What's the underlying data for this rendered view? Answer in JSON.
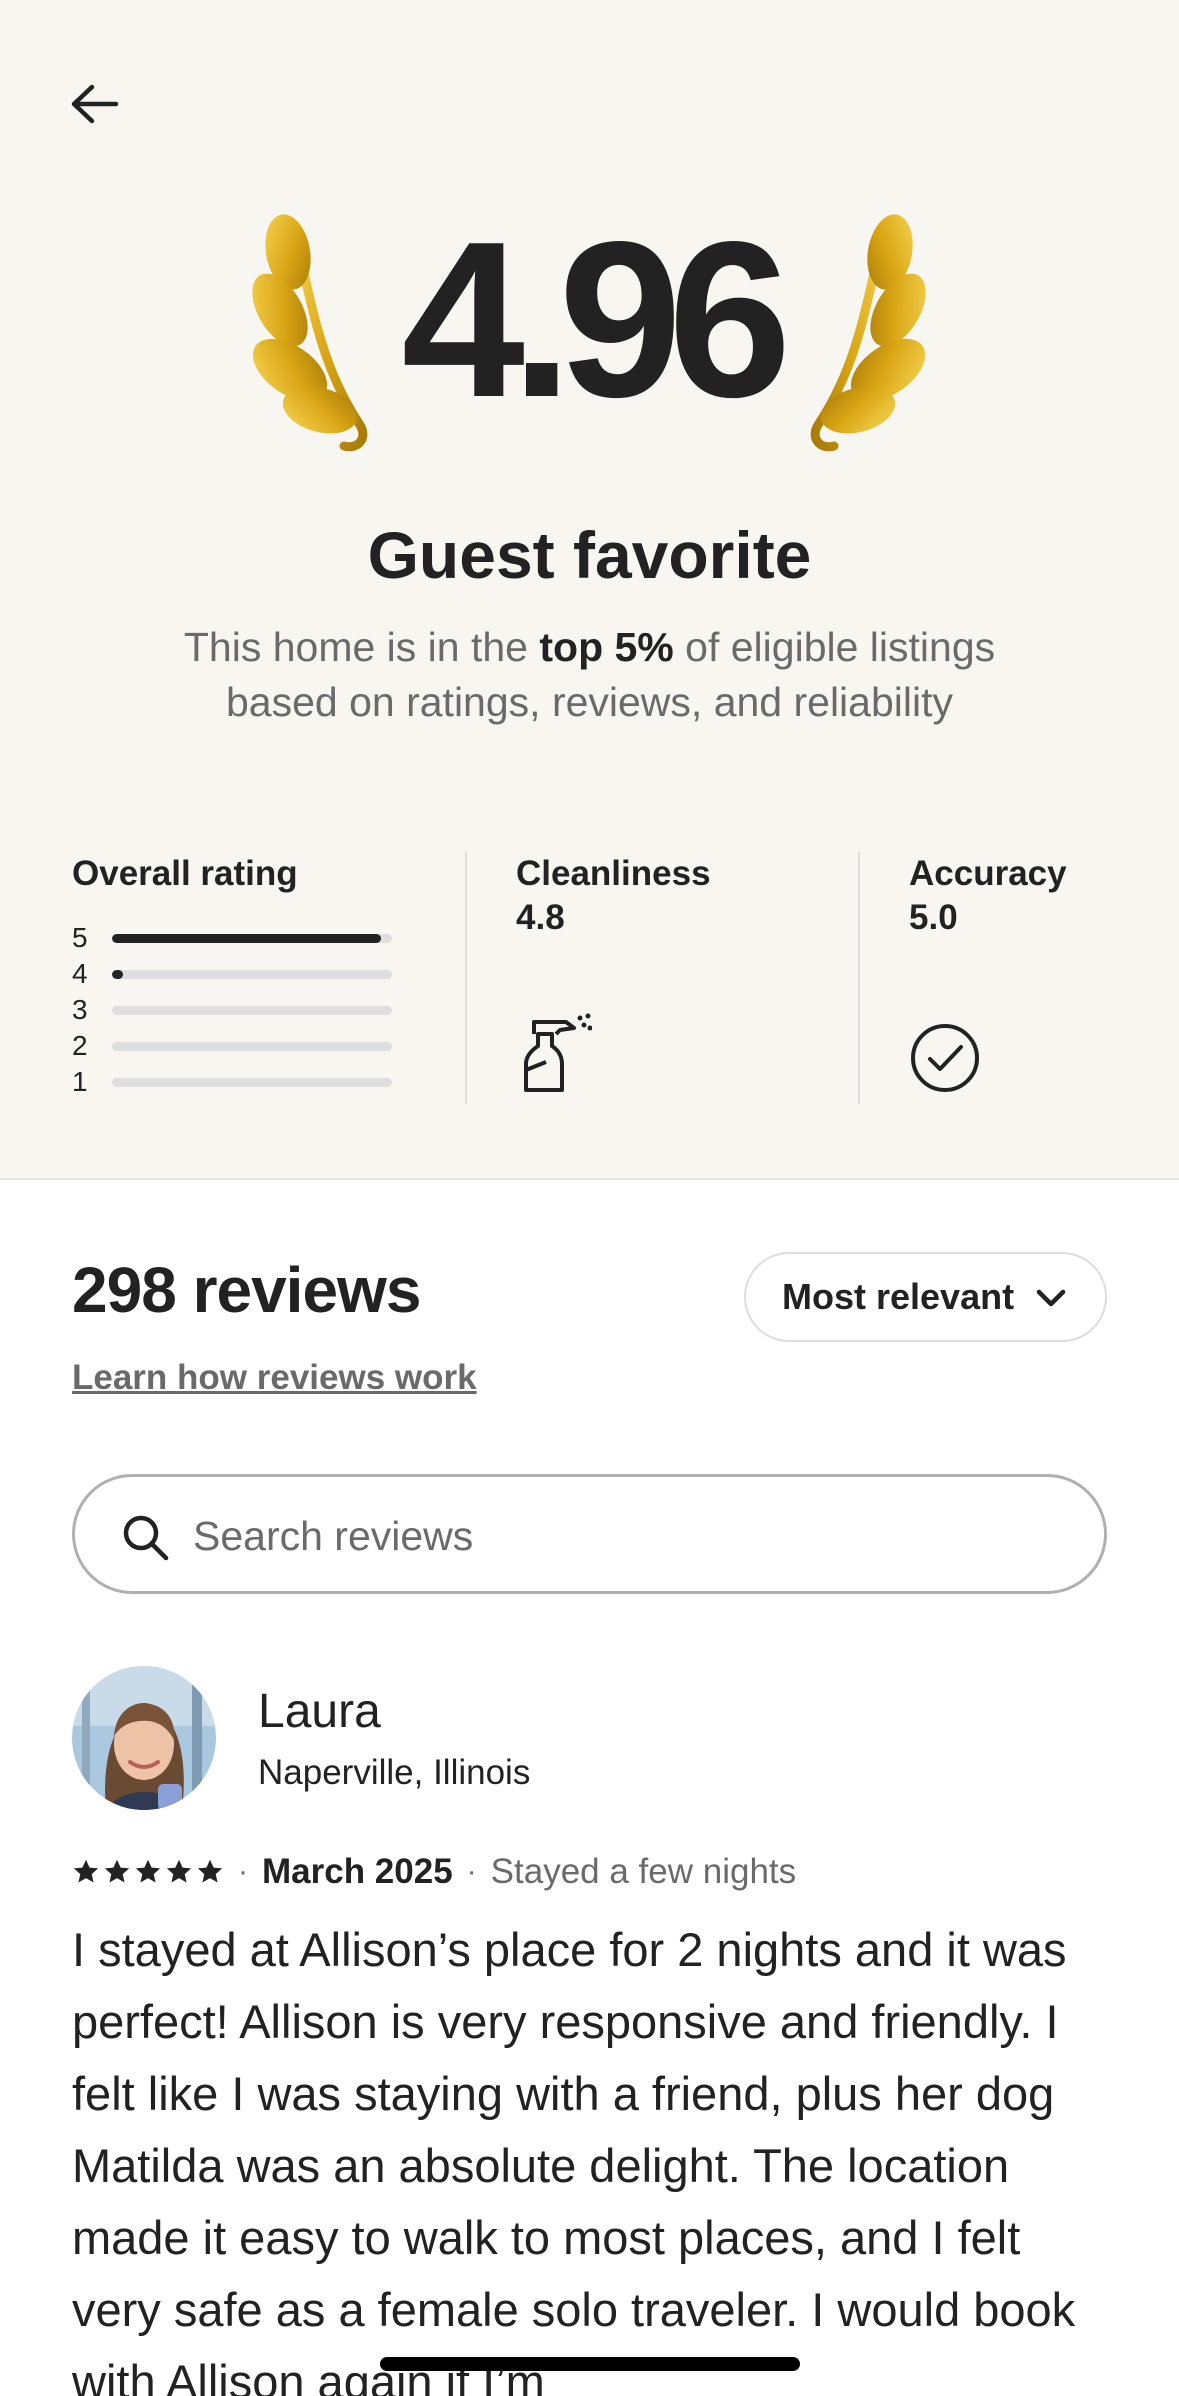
{
  "header": {
    "back_icon": "arrow-left-icon",
    "rating": "4.96",
    "title": "Guest favorite",
    "subtitle_prefix": "This home is in the ",
    "subtitle_bold": "top 5%",
    "subtitle_suffix": " of eligible listings based on ratings, reviews, and reliability",
    "laurel_icon": "gold-laurel-icon"
  },
  "stats": {
    "overall": {
      "label": "Overall rating",
      "distribution": [
        {
          "stars": "5",
          "fraction": 0.96
        },
        {
          "stars": "4",
          "fraction": 0.04
        },
        {
          "stars": "3",
          "fraction": 0.0
        },
        {
          "stars": "2",
          "fraction": 0.0
        },
        {
          "stars": "1",
          "fraction": 0.0
        }
      ]
    },
    "cleanliness": {
      "label": "Cleanliness",
      "value": "4.8",
      "icon": "spray-bottle-icon"
    },
    "accuracy": {
      "label": "Accuracy",
      "value": "5.0",
      "icon": "check-circle-icon"
    }
  },
  "reviews": {
    "count_label": "298 reviews",
    "learn_link": "Learn how reviews work",
    "sort_label": "Most relevant",
    "sort_icon": "chevron-down-icon",
    "search_placeholder": "Search reviews",
    "search_icon": "search-icon",
    "items": [
      {
        "name": "Laura",
        "location": "Naperville, Illinois",
        "rating": 5,
        "date": "March 2025",
        "stay": "Stayed a few nights",
        "text": "I stayed at Allison’s place for 2 nights and it was perfect! Allison is very responsive and friendly. I felt like I was staying with a friend, plus her dog Matilda was an absolute delight. The location made it easy to walk to most places, and I felt very safe as a female solo traveler. I would book with Allison again if I’m"
      }
    ]
  },
  "colors": {
    "hero_bg": "#f8f6f1",
    "text_primary": "#222222",
    "text_secondary": "#6a6a6a",
    "gold": "#d9a514"
  }
}
